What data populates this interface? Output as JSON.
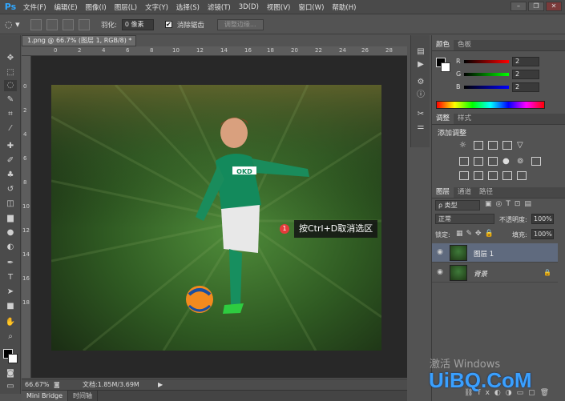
{
  "app": {
    "logo": "Ps"
  },
  "menu": [
    "文件(F)",
    "编辑(E)",
    "图像(I)",
    "图层(L)",
    "文字(Y)",
    "选择(S)",
    "滤镜(T)",
    "3D(D)",
    "视图(V)",
    "窗口(W)",
    "帮助(H)"
  ],
  "window_controls": {
    "minimize": "–",
    "restore": "❐",
    "close": "✕"
  },
  "options": {
    "feather_label": "羽化:",
    "feather_value": "0 像素",
    "antialias_label": "消除锯齿",
    "antialias_checked": "✔",
    "refine_button": "调整边缘..."
  },
  "document": {
    "tab_title": "1.png @ 66.7% (图层 1, RGB/8) *",
    "tab_close": "×",
    "zoom": "66.67%",
    "doc_info": "文档:1.85M/3.69M",
    "ruler_top": [
      "0",
      "2",
      "4",
      "6",
      "8",
      "10",
      "12",
      "14",
      "16",
      "18",
      "20",
      "22",
      "24",
      "26",
      "28"
    ],
    "ruler_left": [
      "0",
      "2",
      "4",
      "6",
      "8",
      "10",
      "12",
      "14",
      "16",
      "18"
    ],
    "callout_number": "1",
    "callout_text": "按Ctrl+D取消选区",
    "jersey_text": "OKD"
  },
  "bottom_tabs": [
    "Mini Bridge",
    "时间轴"
  ],
  "color_panel": {
    "tabs": [
      "颜色",
      "色板"
    ],
    "channels": [
      {
        "label": "R",
        "value": "2"
      },
      {
        "label": "G",
        "value": "2"
      },
      {
        "label": "B",
        "value": "2"
      }
    ]
  },
  "adjust_panel": {
    "tabs": [
      "调整",
      "样式"
    ],
    "title": "添加调整"
  },
  "layers_panel": {
    "tabs": [
      "图层",
      "通道",
      "路径"
    ],
    "filter_label": "ρ 类型",
    "blend_mode": "正常",
    "opacity_label": "不透明度:",
    "opacity_value": "100%",
    "lock_label": "锁定:",
    "fill_label": "填充:",
    "fill_value": "100%",
    "layers": [
      {
        "name": "图层 1",
        "selected": true
      },
      {
        "name": "背景",
        "selected": false
      }
    ]
  },
  "watermark": "激活 Windows",
  "brand": "UiBQ.CoM"
}
